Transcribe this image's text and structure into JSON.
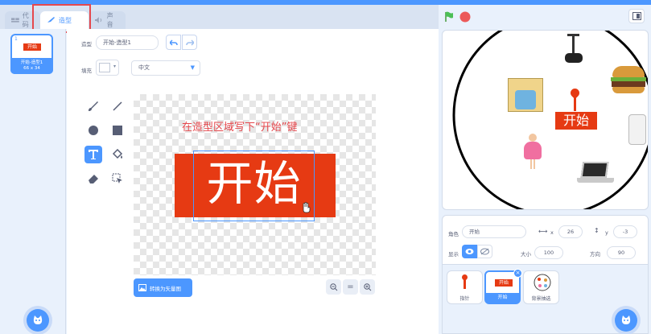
{
  "tabs": {
    "code": "代码",
    "costumes": "造型",
    "sounds": "声音"
  },
  "costume_list": {
    "thumb_number": "1",
    "thumb_text": "开始",
    "thumb_name": "开始-造型1",
    "thumb_size": "66 x 34"
  },
  "editor": {
    "costume_label": "造型",
    "costume_name": "开始-造型1",
    "fill_label": "填充",
    "font_value": "中文",
    "convert_button": "转换为矢量图",
    "zoom_out": "−",
    "zoom_reset": "=",
    "zoom_in": "+"
  },
  "canvas": {
    "instruction": "在造型区域写下“开始”键",
    "big_text": "开始"
  },
  "stage": {
    "center_text": "开始"
  },
  "sprite_info": {
    "sprite_label": "角色",
    "sprite_name": "开始",
    "x_label": "x",
    "x_value": "26",
    "y_label": "y",
    "y_value": "-3",
    "show_label": "显示",
    "size_label": "大小",
    "size_value": "100",
    "direction_label": "方向",
    "direction_value": "90"
  },
  "sprites": [
    {
      "name": "指针"
    },
    {
      "name": "开始"
    },
    {
      "name": "背景抽选"
    }
  ],
  "colors": {
    "accent": "#4c97ff",
    "highlight": "#e5484d",
    "sprite_red": "#e63a13"
  }
}
